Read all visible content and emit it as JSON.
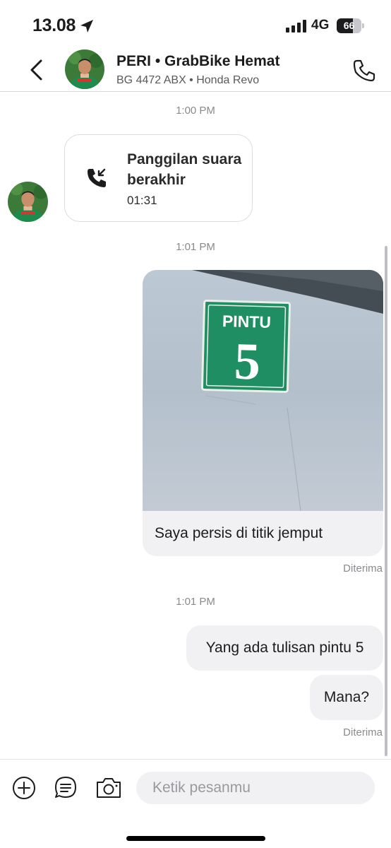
{
  "status_bar": {
    "time": "13.08",
    "network": "4G",
    "battery": "66",
    "battery_level": 0.66,
    "location_icon": "location-arrow-icon",
    "signal_icon": "cellular-signal-icon"
  },
  "header": {
    "driver_name": "PERI • GrabBike Hemat",
    "vehicle": "BG 4472 ABX • Honda Revo",
    "back_icon": "chevron-left-icon",
    "call_icon": "phone-icon"
  },
  "messages": {
    "time_1": "1:00 PM",
    "call_card": {
      "title": "Panggilan suara berakhir",
      "duration": "01:31",
      "icon": "incoming-call-icon"
    },
    "time_2": "1:01 PM",
    "photo": {
      "sign_word": "PINTU",
      "sign_number": "5",
      "caption": "Saya persis di titik jemput",
      "status": "Diterima"
    },
    "time_3": "1:01 PM",
    "text_1": "Yang ada tulisan pintu 5",
    "text_2": "Mana?",
    "status_2": "Diterima"
  },
  "composer": {
    "placeholder": "Ketik pesanmu",
    "add_icon": "plus-circle-icon",
    "quick_reply_icon": "message-lines-icon",
    "camera_icon": "camera-icon"
  },
  "colors": {
    "brand_green": "#1d8a4e",
    "bubble_gray": "#f1f1f3",
    "muted_text": "#8a8a8e",
    "sign_green": "#1f8e62"
  }
}
